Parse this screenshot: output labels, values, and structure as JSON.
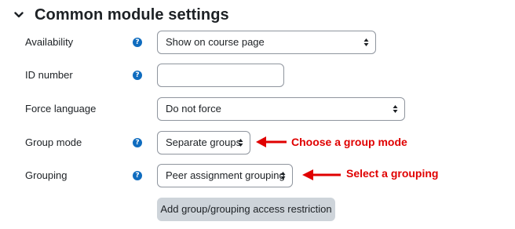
{
  "section": {
    "title": "Common module settings"
  },
  "fields": {
    "availability": {
      "label": "Availability",
      "value": "Show on course page"
    },
    "id_number": {
      "label": "ID number",
      "value": ""
    },
    "force_language": {
      "label": "Force language",
      "value": "Do not force"
    },
    "group_mode": {
      "label": "Group mode",
      "value": "Separate groups"
    },
    "grouping": {
      "label": "Grouping",
      "value": "Peer assignment grouping"
    }
  },
  "help_icon_glyph": "?",
  "actions": {
    "add_restriction_label": "Add group/grouping access restriction"
  },
  "annotations": {
    "group_mode": "Choose a group mode",
    "grouping": "Select a grouping"
  },
  "colors": {
    "accent": "#0f6cbf",
    "annotation": "#e00000",
    "button_secondary": "#ced4da",
    "border": "#8f959e"
  },
  "icons": {
    "section_toggle": "chevron-down-icon",
    "help": "question-circle-icon",
    "select_arrows": "sort-arrows-icon",
    "annotation_arrow": "arrow-left-icon"
  }
}
